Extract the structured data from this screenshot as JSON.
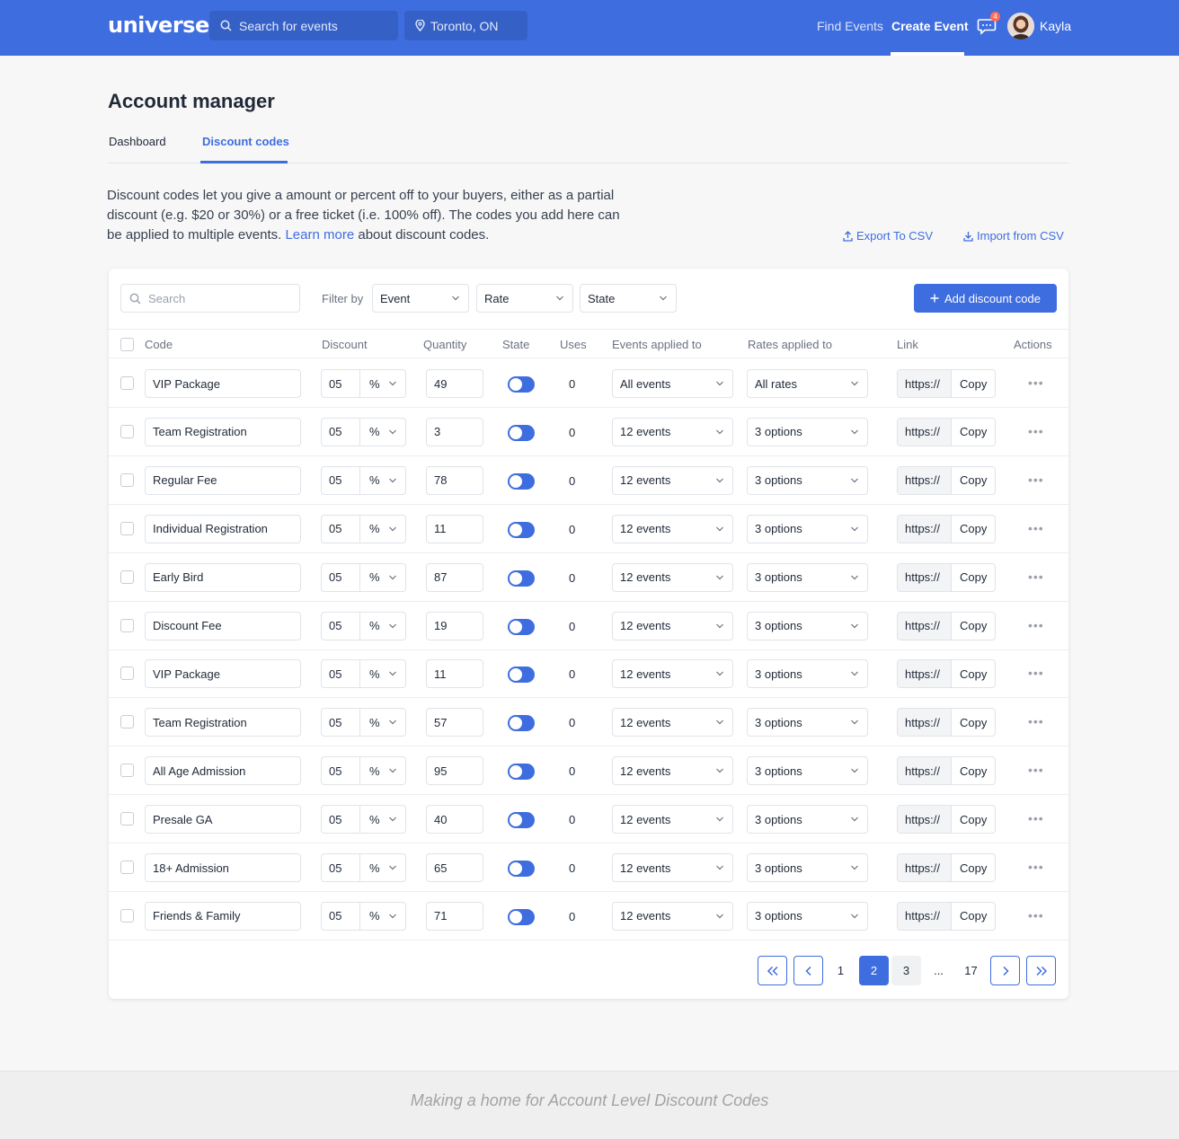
{
  "app": {
    "logo": "universe",
    "search_placeholder": "Search for events",
    "location": "Toronto, ON",
    "nav": {
      "find_events": "Find Events",
      "create_event": "Create Event"
    },
    "notifications": "4",
    "user_name": "Kayla"
  },
  "page": {
    "title": "Account manager",
    "tabs": [
      {
        "label": "Dashboard"
      },
      {
        "label": "Discount codes"
      }
    ],
    "intro_before": "Discount codes let you give a amount or percent off to your buyers, either as a partial discount (e.g. $20 or 30%) or a free ticket (i.e. 100% off). The codes you add here can be applied to multiple events.",
    "intro_link": "Learn more",
    "intro_after": "about discount codes.",
    "export_csv": "Export To CSV",
    "import_csv": "Import from CSV"
  },
  "toolbar": {
    "search_placeholder": "Search",
    "filter_label": "Filter by",
    "filters": [
      {
        "label": "Event"
      },
      {
        "label": "Rate"
      },
      {
        "label": "State"
      }
    ],
    "add_button": "Add discount code"
  },
  "columns": [
    "Code",
    "Discount",
    "Quantity",
    "State",
    "Uses",
    "Events applied to",
    "Rates applied to",
    "Link",
    "Actions"
  ],
  "rows": [
    {
      "code": "VIP Package",
      "discount": "05",
      "unit": "%",
      "quantity": "49",
      "uses": "0",
      "events": "All events",
      "rates": "All rates",
      "link": "https://",
      "copy": "Copy"
    },
    {
      "code": "Team Registration",
      "discount": "05",
      "unit": "%",
      "quantity": "3",
      "uses": "0",
      "events": "12 events",
      "rates": "3 options",
      "link": "https://",
      "copy": "Copy"
    },
    {
      "code": "Regular Fee",
      "discount": "05",
      "unit": "%",
      "quantity": "78",
      "uses": "0",
      "events": "12 events",
      "rates": "3 options",
      "link": "https://",
      "copy": "Copy"
    },
    {
      "code": "Individual Registration",
      "discount": "05",
      "unit": "%",
      "quantity": "11",
      "uses": "0",
      "events": "12 events",
      "rates": "3 options",
      "link": "https://",
      "copy": "Copy"
    },
    {
      "code": "Early Bird",
      "discount": "05",
      "unit": "%",
      "quantity": "87",
      "uses": "0",
      "events": "12 events",
      "rates": "3 options",
      "link": "https://",
      "copy": "Copy"
    },
    {
      "code": "Discount Fee",
      "discount": "05",
      "unit": "%",
      "quantity": "19",
      "uses": "0",
      "events": "12 events",
      "rates": "3 options",
      "link": "https://",
      "copy": "Copy"
    },
    {
      "code": "VIP Package",
      "discount": "05",
      "unit": "%",
      "quantity": "11",
      "uses": "0",
      "events": "12 events",
      "rates": "3 options",
      "link": "https://",
      "copy": "Copy"
    },
    {
      "code": "Team Registration",
      "discount": "05",
      "unit": "%",
      "quantity": "57",
      "uses": "0",
      "events": "12 events",
      "rates": "3 options",
      "link": "https://",
      "copy": "Copy"
    },
    {
      "code": "All Age Admission",
      "discount": "05",
      "unit": "%",
      "quantity": "95",
      "uses": "0",
      "events": "12 events",
      "rates": "3 options",
      "link": "https://",
      "copy": "Copy"
    },
    {
      "code": "Presale GA",
      "discount": "05",
      "unit": "%",
      "quantity": "40",
      "uses": "0",
      "events": "12 events",
      "rates": "3 options",
      "link": "https://",
      "copy": "Copy"
    },
    {
      "code": "18+ Admission",
      "discount": "05",
      "unit": "%",
      "quantity": "65",
      "uses": "0",
      "events": "12 events",
      "rates": "3 options",
      "link": "https://",
      "copy": "Copy"
    },
    {
      "code": "Friends & Family",
      "discount": "05",
      "unit": "%",
      "quantity": "71",
      "uses": "0",
      "events": "12 events",
      "rates": "3 options",
      "link": "https://",
      "copy": "Copy"
    }
  ],
  "pagination": {
    "pages": [
      "1",
      "2",
      "3",
      "...",
      "17"
    ],
    "current": "2"
  },
  "footer": {
    "caption": "Making a home for Account Level Discount Codes"
  },
  "colors": {
    "accent": "#3e6ddf",
    "badge": "#ff6b57"
  }
}
